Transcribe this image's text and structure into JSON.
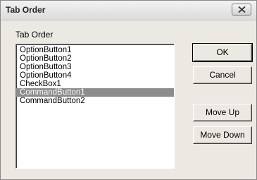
{
  "window": {
    "title": "Tab Order"
  },
  "group": {
    "label": "Tab Order"
  },
  "list": {
    "items": [
      "OptionButton1",
      "OptionButton2",
      "OptionButton3",
      "OptionButton4",
      "CheckBox1",
      "CommandButton1",
      "CommandButton2"
    ],
    "selected": "CommandButton1"
  },
  "buttons": {
    "ok": "OK",
    "cancel": "Cancel",
    "move_up": "Move Up",
    "move_down": "Move Down"
  },
  "icons": {
    "close": "close-icon"
  }
}
